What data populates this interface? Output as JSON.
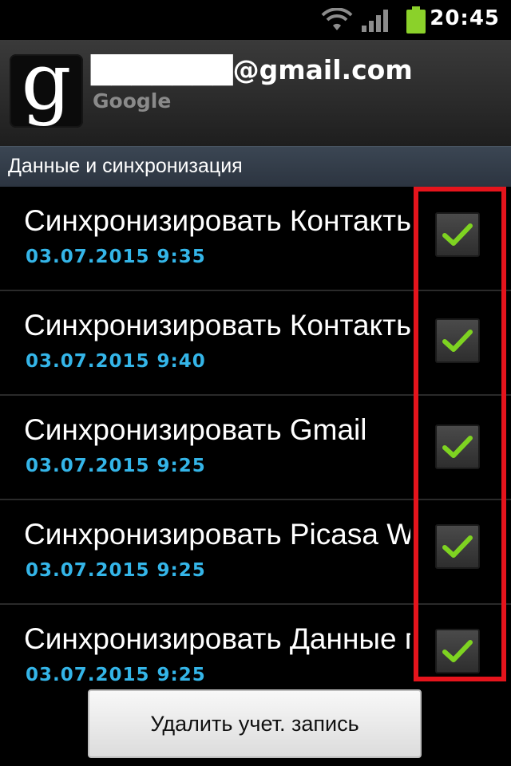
{
  "status_bar": {
    "time": "20:45",
    "icons": [
      "wifi-icon",
      "signal-icon",
      "battery-icon"
    ],
    "battery_color": "#8bd12a"
  },
  "account": {
    "email": "███████@gmail.com",
    "type": "Google",
    "icon": "google-g-icon"
  },
  "section": {
    "title": "Данные и синхронизация"
  },
  "sync_items": [
    {
      "title": "Синхронизировать Контакты",
      "date": "03.07.2015 9:35",
      "checked": true
    },
    {
      "title": "Синхронизировать Контакты",
      "date": "03.07.2015 9:40",
      "checked": true
    },
    {
      "title": "Синхронизировать Gmail",
      "date": "03.07.2015 9:25",
      "checked": true
    },
    {
      "title": "Синхронизировать Picasa Web",
      "date": "03.07.2015 9:25",
      "checked": true
    },
    {
      "title": "Синхронизировать Данные п",
      "date": "03.07.2015 9:25",
      "checked": true
    }
  ],
  "footer": {
    "delete_label": "Удалить учет. запись"
  },
  "colors": {
    "date_text": "#34b5e8",
    "checkmark": "#7ed321",
    "highlight": "#e5141c",
    "section_bg": "#333d49"
  }
}
